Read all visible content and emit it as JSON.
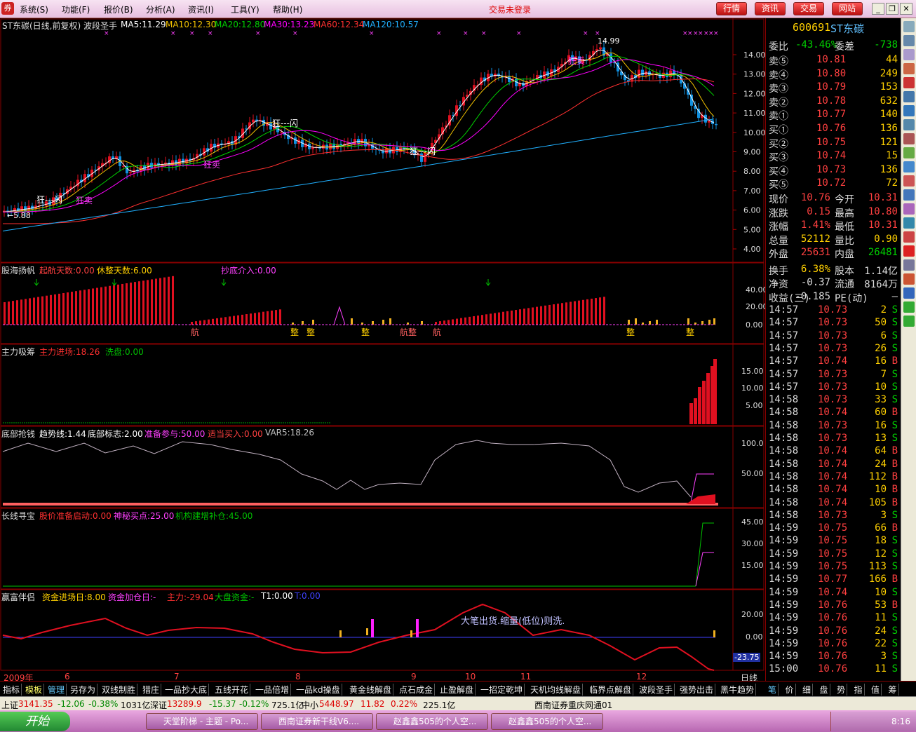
{
  "menu": [
    "系统(S)",
    "功能(F)",
    "报价(B)",
    "分析(A)",
    "资讯(I)",
    "工具(Y)",
    "帮助(H)"
  ],
  "status": "交易未登录",
  "top_buttons": [
    "行情",
    "资讯",
    "交易",
    "网站"
  ],
  "main_chart": {
    "title": "ST东碳(日线,前复权) 波段圣手",
    "ma": [
      {
        "name": "MA5:11.29",
        "color": "#ffffff"
      },
      {
        "name": "MA10:12.30",
        "color": "#f0c000"
      },
      {
        "name": "MA20:12.80",
        "color": "#00d000"
      },
      {
        "name": "MA30:13.23",
        "color": "#ff00ff"
      },
      {
        "name": "MA60:12.34",
        "color": "#ff3030"
      },
      {
        "name": "MA120:10.57",
        "color": "#20b0ff"
      }
    ],
    "y_ticks": [
      "14.00",
      "13.00",
      "12.00",
      "11.00",
      "10.00",
      "9.00",
      "8.00",
      "7.00",
      "6.00",
      "5.00",
      "4.00"
    ],
    "annotations": [
      "←5.88",
      "14.99",
      "狂---闪",
      "狂卖"
    ]
  },
  "panels": [
    {
      "title": "股海扬帆",
      "items": [
        {
          "t": "起航天数:0.00",
          "c": "#ff4040"
        },
        {
          "t": "休整天数:6.00",
          "c": "#ffd000"
        },
        {
          "t": "抄底介入:0.00",
          "c": "#ff40ff"
        }
      ],
      "ticks": [
        "40.00",
        "20.00",
        "0.00"
      ]
    },
    {
      "title": "主力吸筹",
      "items": [
        {
          "t": "主力进场:18.26",
          "c": "#ff3030"
        },
        {
          "t": "洗盘:0.00",
          "c": "#00c000"
        }
      ],
      "ticks": [
        "15.00",
        "10.00",
        "5.00"
      ]
    },
    {
      "title": "底部抢钱",
      "items": [
        {
          "t": "趋势线:1.44",
          "c": "#ffffff"
        },
        {
          "t": "底部标志:2.00",
          "c": "#ffffff"
        },
        {
          "t": "准备参与:50.00",
          "c": "#ff40ff"
        },
        {
          "t": "适当买入:0.00",
          "c": "#ff4040"
        },
        {
          "t": "VAR5:18.26",
          "c": "#c0c0c0"
        }
      ],
      "ticks": [
        "100.0",
        "50.00"
      ]
    },
    {
      "title": "长线寻宝",
      "items": [
        {
          "t": "股价准备启动:0.00",
          "c": "#ff3030"
        },
        {
          "t": "神秘买点:25.00",
          "c": "#ff40ff"
        },
        {
          "t": "机构建增补仓:45.00",
          "c": "#00c000"
        }
      ],
      "ticks": [
        "45.00",
        "30.00",
        "15.00"
      ]
    },
    {
      "title": "赢富伴侣",
      "items": [
        {
          "t": "资金进场日:8.00",
          "c": "#ffd000"
        },
        {
          "t": "资金加仓日:-",
          "c": "#ff40ff"
        },
        {
          "t": "主力:-29.04",
          "c": "#ff3030"
        },
        {
          "t": "大盘资金:-",
          "c": "#00c000"
        },
        {
          "t": "T1:0.00",
          "c": "#ffffff"
        },
        {
          "t": "T:0.00",
          "c": "#4040ff"
        }
      ],
      "ticks": [
        "20.00",
        "0.00",
        "-23.75"
      ],
      "note": "大笔出货.缩量(低位)则洗."
    }
  ],
  "panel_marks": [
    "航",
    "整",
    "整",
    "整",
    "航整",
    "航",
    "整",
    "整"
  ],
  "x_axis": [
    "2009年",
    "6",
    "7",
    "8",
    "9",
    "10",
    "11",
    "12"
  ],
  "x_axis_right": "日线",
  "quote": {
    "code": "600691",
    "name": "ST东碳",
    "weibi_label": "委比",
    "weibi": "-43.46%",
    "weicha_label": "委差",
    "weicha": "-738",
    "asks": [
      {
        "label": "卖⑤",
        "price": "10.81",
        "vol": "44"
      },
      {
        "label": "卖④",
        "price": "10.80",
        "vol": "249"
      },
      {
        "label": "卖③",
        "price": "10.79",
        "vol": "153"
      },
      {
        "label": "卖②",
        "price": "10.78",
        "vol": "632"
      },
      {
        "label": "卖①",
        "price": "10.77",
        "vol": "140"
      }
    ],
    "bids": [
      {
        "label": "买①",
        "price": "10.76",
        "vol": "136"
      },
      {
        "label": "买②",
        "price": "10.75",
        "vol": "121"
      },
      {
        "label": "买③",
        "price": "10.74",
        "vol": "15"
      },
      {
        "label": "买④",
        "price": "10.73",
        "vol": "136"
      },
      {
        "label": "买⑤",
        "price": "10.72",
        "vol": "72"
      }
    ],
    "stats": [
      {
        "l1": "现价",
        "v1": "10.76",
        "l2": "今开",
        "v2": "10.31"
      },
      {
        "l1": "涨跌",
        "v1": "0.15",
        "l2": "最高",
        "v2": "10.80"
      },
      {
        "l1": "涨幅",
        "v1": "1.41%",
        "l2": "最低",
        "v2": "10.31"
      },
      {
        "l1": "总量",
        "v1": "52112",
        "l2": "量比",
        "v2": "0.90"
      },
      {
        "l1": "外盘",
        "v1": "25631",
        "l2": "内盘",
        "v2": "26481"
      },
      {
        "l1": "换手",
        "v1": "6.38%",
        "l2": "股本",
        "v2": "1.14亿"
      },
      {
        "l1": "净资",
        "v1": "-0.37",
        "l2": "流通",
        "v2": "8164万"
      },
      {
        "l1": "收益(三)",
        "v1": "-0.185",
        "l2": "PE(动)",
        "v2": "—"
      }
    ],
    "ticks": [
      [
        "14:57",
        "10.73",
        "2",
        "S"
      ],
      [
        "14:57",
        "10.73",
        "50",
        "S"
      ],
      [
        "14:57",
        "10.73",
        "6",
        "S"
      ],
      [
        "14:57",
        "10.73",
        "26",
        "S"
      ],
      [
        "14:57",
        "10.74",
        "16",
        "B"
      ],
      [
        "14:57",
        "10.73",
        "7",
        "S"
      ],
      [
        "14:57",
        "10.73",
        "10",
        "S"
      ],
      [
        "14:58",
        "10.73",
        "33",
        "S"
      ],
      [
        "14:58",
        "10.74",
        "60",
        "B"
      ],
      [
        "14:58",
        "10.73",
        "16",
        "S"
      ],
      [
        "14:58",
        "10.73",
        "13",
        "S"
      ],
      [
        "14:58",
        "10.74",
        "64",
        "B"
      ],
      [
        "14:58",
        "10.74",
        "24",
        "B"
      ],
      [
        "14:58",
        "10.74",
        "112",
        "B"
      ],
      [
        "14:58",
        "10.74",
        "10",
        "B"
      ],
      [
        "14:58",
        "10.74",
        "105",
        "B"
      ],
      [
        "14:58",
        "10.73",
        "3",
        "S"
      ],
      [
        "14:59",
        "10.75",
        "66",
        "B"
      ],
      [
        "14:59",
        "10.75",
        "18",
        "S"
      ],
      [
        "14:59",
        "10.75",
        "12",
        "S"
      ],
      [
        "14:59",
        "10.75",
        "113",
        "S"
      ],
      [
        "14:59",
        "10.77",
        "166",
        "B"
      ],
      [
        "14:59",
        "10.74",
        "10",
        "S"
      ],
      [
        "14:59",
        "10.76",
        "53",
        "B"
      ],
      [
        "14:59",
        "10.76",
        "11",
        "S"
      ],
      [
        "14:59",
        "10.76",
        "24",
        "S"
      ],
      [
        "14:59",
        "10.76",
        "22",
        "S"
      ],
      [
        "14:59",
        "10.76",
        "3",
        "S"
      ],
      [
        "15:00",
        "10.76",
        "11",
        "S"
      ]
    ]
  },
  "bottom_tabs": [
    "指标",
    "模板",
    "管理",
    "另存为",
    "双线制胜",
    "猎庄",
    "一品抄大底",
    "五线开花",
    "一品倍增",
    "一品kd操盘",
    "黄金线解盘",
    "点石成金",
    "止盈解盘",
    "一招定乾坤",
    "天机均线解盘",
    "临界点解盘",
    "波段圣手",
    "强势出击",
    "黑牛趋势"
  ],
  "bottom_right": [
    "笔",
    "价",
    "细",
    "盘",
    "势",
    "指",
    "值",
    "筹"
  ],
  "ticker": {
    "sh_label": "上证",
    "sh": "3141.35",
    "sh_chg": "-12.06",
    "sh_pct": "-0.38%",
    "sh_amt": "1031亿",
    "sz_label": "深证",
    "sz": "13289.9",
    "sz_chg": "-15.37",
    "sz_pct": "-0.12%",
    "sz_amt": "725.1亿",
    "zx_label": "中小",
    "zx": "5448.97",
    "zx_chg": "11.82",
    "zx_pct": "0.22%",
    "zx_amt": "225.1亿",
    "server": "西南证券重庆网通01"
  },
  "taskbar": {
    "start": "开始",
    "tasks": [
      "天堂阶梯 - 主题 - Po...",
      "西南证券新干线V6....",
      "赵鑫鑫505的个人空...",
      "赵鑫鑫505的个人空..."
    ],
    "clock": "8:16"
  }
}
